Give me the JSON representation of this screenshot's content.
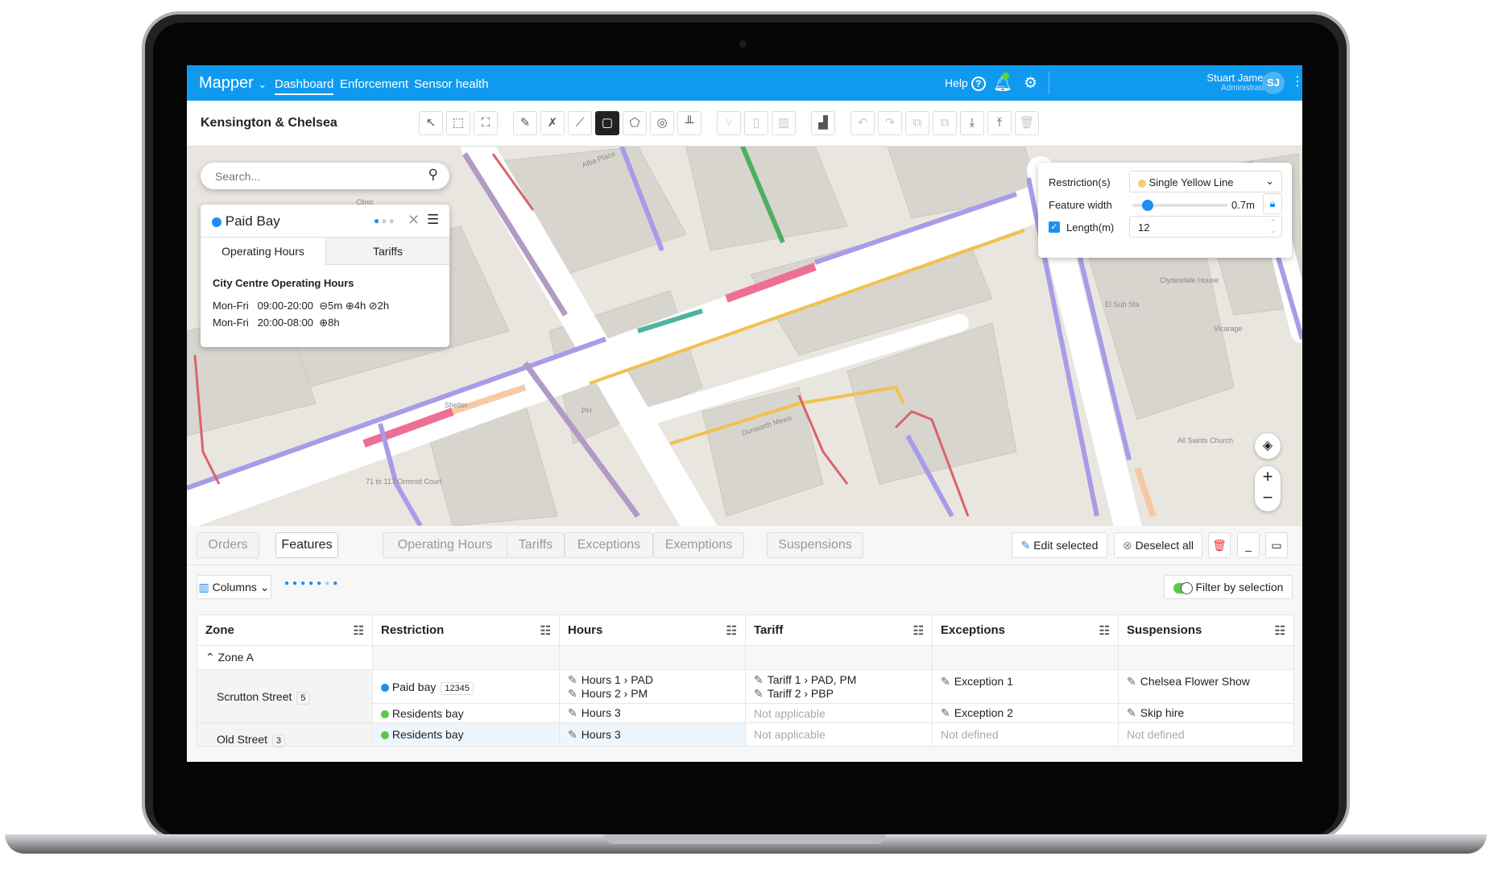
{
  "header": {
    "brand": "Mapper",
    "nav": [
      "Dashboard",
      "Enforcement",
      "Sensor health"
    ],
    "active_nav": "Dashboard",
    "help": "Help",
    "user_name": "Stuart James",
    "user_role": "Administrator",
    "avatar_initials": "SJ",
    "accent": "#0f9af0"
  },
  "toolbar": {
    "area": "Kensington & Chelsea",
    "tools": [
      {
        "icon": "pointer-icon",
        "glyph": "↖"
      },
      {
        "icon": "box-select-icon",
        "glyph": "⬚"
      },
      {
        "icon": "lasso-select-icon",
        "glyph": "⛶"
      },
      {
        "icon": "pencil-icon",
        "glyph": "✎"
      },
      {
        "icon": "erase-line-icon",
        "glyph": "✗"
      },
      {
        "icon": "line-icon",
        "glyph": "⟋"
      },
      {
        "icon": "rectangle-icon",
        "glyph": "▢",
        "active": true
      },
      {
        "icon": "polygon-icon",
        "glyph": "⬠"
      },
      {
        "icon": "circle-icon",
        "glyph": "◎"
      },
      {
        "icon": "parallel-icon",
        "glyph": "╨"
      },
      {
        "icon": "split-icon",
        "glyph": "⑂",
        "disabled": true
      },
      {
        "icon": "column-icon",
        "glyph": "▯",
        "disabled": true
      },
      {
        "icon": "column-split-icon",
        "glyph": "▥",
        "disabled": true
      },
      {
        "icon": "kerb-icon",
        "glyph": "▟"
      },
      {
        "icon": "undo-icon",
        "glyph": "↶",
        "disabled": true
      },
      {
        "icon": "redo-icon",
        "glyph": "↷",
        "disabled": true
      },
      {
        "icon": "copy-icon",
        "glyph": "⧉",
        "disabled": true
      },
      {
        "icon": "paste-icon",
        "glyph": "⧉",
        "disabled": true
      },
      {
        "icon": "download-icon",
        "glyph": "⤓"
      },
      {
        "icon": "upload-icon",
        "glyph": "⤒"
      },
      {
        "icon": "trash-icon",
        "glyph": "🗑",
        "disabled": true
      }
    ]
  },
  "search": {
    "placeholder": "Search..."
  },
  "popup": {
    "title": "Paid Bay",
    "color": "#1e8ff0",
    "tabs": [
      "Operating Hours",
      "Tariffs"
    ],
    "section": "City Centre Operating Hours",
    "rows": [
      {
        "days": "Mon-Fri",
        "time": "09:00-20:00",
        "extras": "⊖5m ⊕4h ⊘2h"
      },
      {
        "days": "Mon-Fri",
        "time": "20:00-08:00",
        "extras": "⊕8h"
      }
    ]
  },
  "restriction_panel": {
    "restriction_label": "Restriction(s)",
    "restriction_value": "Single Yellow Line",
    "restriction_color": "#f5cd6e",
    "width_label": "Feature width",
    "width_value": "0.7m",
    "width_fraction": 0.1,
    "length_label": "Length(m)",
    "length_checked": true,
    "length_value": "12"
  },
  "map_labels": [
    "Clinic",
    "Alba Place",
    "Clydesdale House",
    "Vicarage",
    "El Sub Sta",
    "All Saints Church",
    "Dunworth Mews",
    "PH",
    "71 to 117 Ormrod Court",
    "Shelter"
  ],
  "bottom": {
    "tabs": [
      "Orders",
      "Features"
    ],
    "active_tab": "Features",
    "sub_tabs": [
      "Operating Hours",
      "Tariffs",
      "Exceptions",
      "Exemptions"
    ],
    "suspensions_tab": "Suspensions",
    "edit_selected": "Edit selected",
    "deselect_all": "Deselect all",
    "columns": "Columns",
    "filter_by_selection": "Filter by selection"
  },
  "table": {
    "headers": [
      "Zone",
      "Restriction",
      "Hours",
      "Tariff",
      "Exceptions",
      "Suspensions"
    ],
    "group": "Zone A",
    "rows": [
      {
        "street": "Scrutton Street",
        "count": "5",
        "restriction": "Paid bay",
        "id": "12345",
        "color": "#1e8ff0",
        "hours": [
          "Hours 1 › PAD",
          "Hours 2 › PM"
        ],
        "tariff": [
          "Tariff 1 › PAD, PM",
          "Tariff 2 › PBP"
        ],
        "exceptions": "Exception 1",
        "suspensions": "Chelsea Flower Show"
      },
      {
        "restriction": "Residents bay",
        "color": "#5bc84a",
        "hours": [
          "Hours 3"
        ],
        "tariff": "Not applicable",
        "exceptions": "Exception 2",
        "suspensions": "Skip hire"
      },
      {
        "street": "Old Street",
        "count": "3",
        "restriction": "Residents bay",
        "color": "#5bc84a",
        "hours": [
          "Hours 3"
        ],
        "tariff": "Not applicable",
        "exceptions": "Not defined",
        "suspensions": "Not defined"
      }
    ]
  }
}
